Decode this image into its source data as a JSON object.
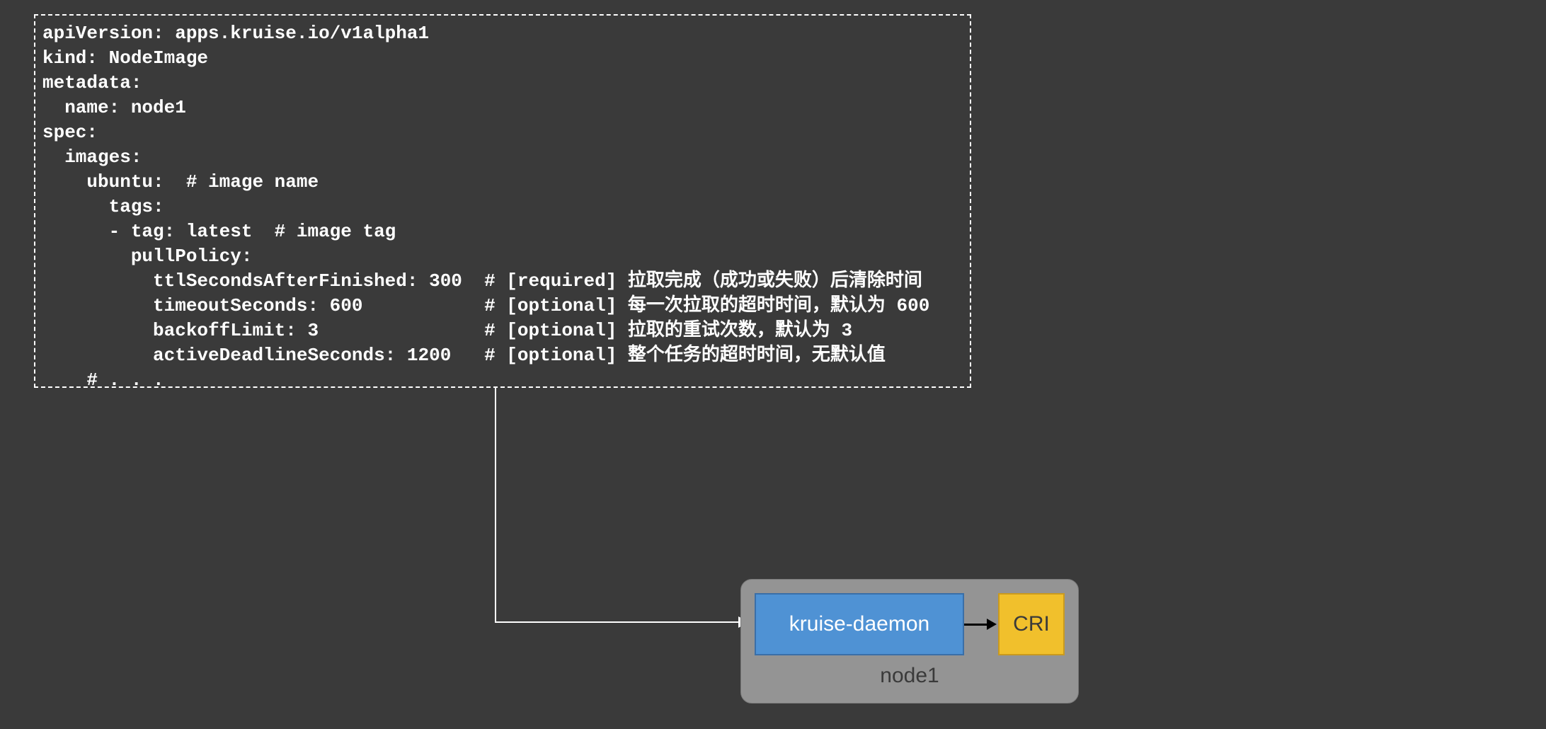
{
  "yaml": {
    "line1": "apiVersion: apps.kruise.io/v1alpha1",
    "line2": "kind: NodeImage",
    "line3": "metadata:",
    "line4": "  name: node1",
    "line5": "spec:",
    "line6": "  images:",
    "line7": "    ubuntu:  # image name",
    "line8": "      tags:",
    "line9": "      - tag: latest  # image tag",
    "line10": "        pullPolicy:",
    "line11": "          ttlSecondsAfterFinished: 300  # [required] 拉取完成（成功或失败）后清除时间",
    "line12": "          timeoutSeconds: 600           # [optional] 每一次拉取的超时时间，默认为 600",
    "line13": "          backoffLimit: 3               # [optional] 拉取的重试次数，默认为 3",
    "line14": "          activeDeadlineSeconds: 1200   # [optional] 整个任务的超时时间，无默认值",
    "line15": "    # . . ."
  },
  "diagram": {
    "daemon_label": "kruise-daemon",
    "cri_label": "CRI",
    "node_label": "node1"
  }
}
